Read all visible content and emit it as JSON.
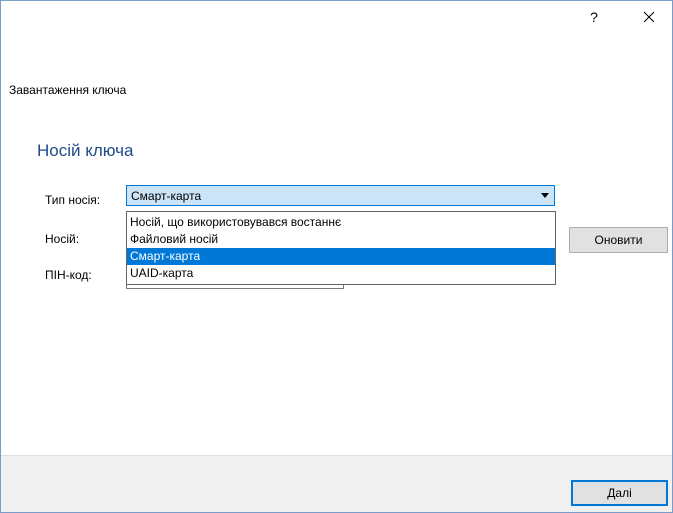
{
  "titlebar": {
    "help_label": "?",
    "close_icon": "close-icon"
  },
  "header": {
    "text": "Завантаження ключа"
  },
  "section": {
    "title": "Носій ключа"
  },
  "form": {
    "type_label": "Тип носія:",
    "media_label": "Носій:",
    "pin_label": "ПІН-код:",
    "type_selected": "Смарт-карта",
    "pin_value": "",
    "type_options": [
      "Носій, що використовувався востаннє",
      "Файловий носій",
      "Смарт-карта",
      "UAID-карта"
    ],
    "refresh_label": "Оновити"
  },
  "footer": {
    "next_label": "Далі"
  },
  "colors": {
    "accent": "#0078d7",
    "section_title": "#1e4a8c",
    "selected_bg": "#0078d7"
  }
}
